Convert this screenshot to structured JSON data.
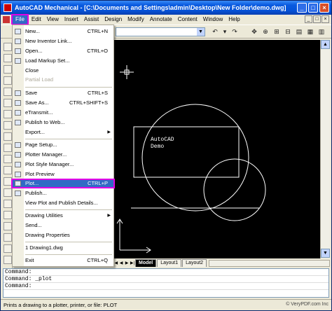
{
  "window": {
    "title": "AutoCAD Mechanical - [C:\\Documents and Settings\\admin\\Desktop\\New Folder\\demo.dwg]",
    "buttons": [
      "_",
      "□",
      "×"
    ]
  },
  "menubar": {
    "items": [
      "File",
      "Edit",
      "View",
      "Insert",
      "Assist",
      "Design",
      "Modify",
      "Annotate",
      "Content",
      "Window",
      "Help"
    ],
    "mdi_buttons": [
      "_",
      "□",
      "×"
    ]
  },
  "file_menu": {
    "items": [
      {
        "label": "New...",
        "shortcut": "CTRL+N",
        "icon": "new-doc-icon"
      },
      {
        "label": "New Inventor Link...",
        "shortcut": "",
        "icon": "inventor-link-icon"
      },
      {
        "label": "Open...",
        "shortcut": "CTRL+O",
        "icon": "open-folder-icon"
      },
      {
        "label": "Load Markup Set...",
        "shortcut": "",
        "icon": "markup-icon"
      },
      {
        "label": "Close",
        "shortcut": ""
      },
      {
        "label": "Partial Load",
        "shortcut": "",
        "disabled": true
      },
      {
        "label": "Save",
        "shortcut": "CTRL+S",
        "icon": "save-icon"
      },
      {
        "label": "Save As...",
        "shortcut": "CTRL+SHIFT+S",
        "icon": "save-as-icon"
      },
      {
        "label": "eTransmit...",
        "shortcut": "",
        "icon": "etransmit-icon"
      },
      {
        "label": "Publish to Web...",
        "shortcut": "",
        "icon": "publish-web-icon"
      },
      {
        "label": "Export...",
        "shortcut": "",
        "submenu": true
      },
      {
        "label": "Page Setup...",
        "shortcut": "",
        "icon": "page-setup-icon"
      },
      {
        "label": "Plotter Manager...",
        "shortcut": "",
        "icon": "plotter-manager-icon"
      },
      {
        "label": "Plot Style Manager...",
        "shortcut": "",
        "icon": "plot-style-icon"
      },
      {
        "label": "Plot Preview",
        "shortcut": "",
        "icon": "plot-preview-icon"
      },
      {
        "label": "Plot...",
        "shortcut": "CTRL+P",
        "icon": "plot-icon",
        "highlighted": true
      },
      {
        "label": "Publish...",
        "shortcut": "",
        "icon": "publish-icon"
      },
      {
        "label": "View Plot and Publish Details...",
        "shortcut": ""
      },
      {
        "label": "Drawing Utilities",
        "shortcut": "",
        "submenu": true
      },
      {
        "label": "Send...",
        "shortcut": ""
      },
      {
        "label": "Drawing Properties",
        "shortcut": ""
      },
      {
        "label": "1 Drawing1.dwg",
        "shortcut": ""
      },
      {
        "label": "Exit",
        "shortcut": "CTRL+Q"
      }
    ]
  },
  "drawing": {
    "text_line1": "AutoCAD",
    "text_line2": "Demo"
  },
  "layout_tabs": [
    "Model",
    "Layout1",
    "Layout2"
  ],
  "command_lines": [
    "Command:",
    "Command: _plot",
    "Command:"
  ],
  "status_text": "Prints a drawing to a plotter, printer, or file:  PLOT",
  "watermark": "© VeryPDF.com Inc",
  "colors": {
    "highlight": "#e100e6",
    "menu_selection": "#316ac5",
    "title_bar": "#0552d8"
  }
}
